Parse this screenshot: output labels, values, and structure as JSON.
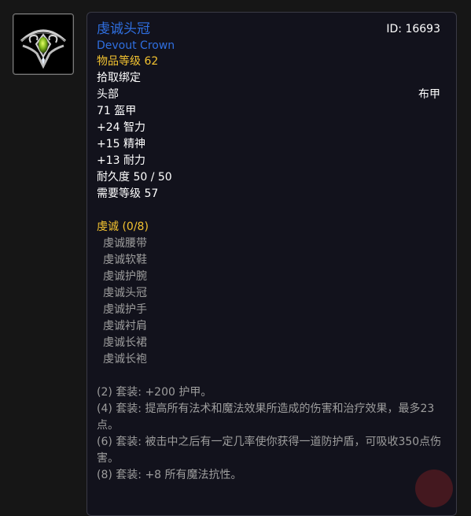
{
  "item": {
    "icon": "devout-crown-icon",
    "name_zh": "虔诚头冠",
    "name_en": "Devout Crown",
    "id_label": "ID: 16693",
    "item_level": "物品等级 62",
    "binding": "拾取绑定",
    "slot": "头部",
    "armor_type": "布甲",
    "armor": "71 盔甲",
    "stats": [
      "+24 智力",
      "+15 精神",
      "+13 耐力"
    ],
    "durability": "耐久度 50 / 50",
    "required_level": "需要等级 57"
  },
  "set": {
    "title": "虔诚 (0/8)",
    "pieces": [
      "虔诚腰带",
      "虔诚软鞋",
      "虔诚护腕",
      "虔诚头冠",
      "虔诚护手",
      "虔诚衬肩",
      "虔诚长裙",
      "虔诚长袍"
    ],
    "bonuses": [
      "(2) 套装: +200 护甲。",
      "(4) 套装: 提高所有法术和魔法效果所造成的伤害和治疗效果，最多23点。",
      "(6) 套装: 被击中之后有一定几率使你获得一道防护盾，可吸收350点伤害。",
      "(8) 套装: +8 所有魔法抗性。"
    ]
  },
  "colors": {
    "item_name": "#2f6fe0",
    "item_level": "#f2c230",
    "set_title": "#f2c230",
    "set_inactive": "#9d9d9d",
    "text": "#ffffff"
  }
}
